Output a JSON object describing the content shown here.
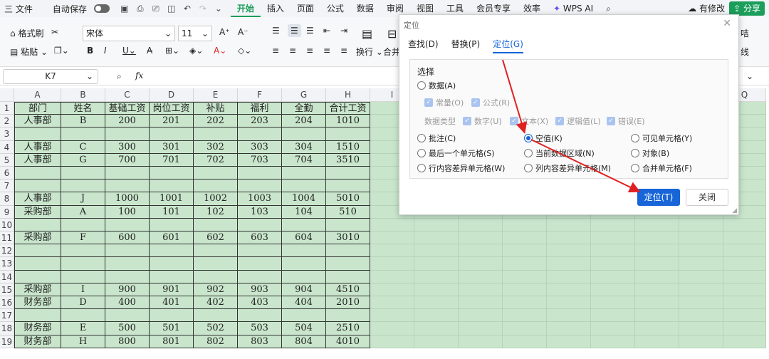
{
  "menubar": {
    "file": "三 文件",
    "autosave": "自动保存",
    "tabs": [
      "开始",
      "插入",
      "页面",
      "公式",
      "数据",
      "审阅",
      "视图",
      "工具",
      "会员专享",
      "效率"
    ],
    "wps_ai": "WPS AI",
    "modify": "有修改",
    "share": "分享"
  },
  "ribbon": {
    "format_painter": "格式刷",
    "paste": "粘贴",
    "font_name": "宋体",
    "font_size": "11",
    "wrap": "换行",
    "merge": "合并",
    "right_cut1": "咭",
    "right_cut2": "线"
  },
  "formula": {
    "namebox": "K7",
    "fx": "fx"
  },
  "grid": {
    "columns": [
      "A",
      "B",
      "C",
      "D",
      "E",
      "F",
      "G",
      "H",
      "I",
      "",
      "",
      "",
      "",
      "",
      "",
      "",
      "Q"
    ],
    "rows": [
      {
        "n": "1",
        "cells": [
          "部门",
          "姓名",
          "基础工资",
          "岗位工资",
          "补贴",
          "福利",
          "全勤",
          "合计工资"
        ]
      },
      {
        "n": "2",
        "cells": [
          "人事部",
          "B",
          "200",
          "201",
          "202",
          "203",
          "204",
          "1010"
        ]
      },
      {
        "n": "3",
        "cells": [
          "",
          "",
          "",
          "",
          "",
          "",
          "",
          ""
        ]
      },
      {
        "n": "4",
        "cells": [
          "人事部",
          "C",
          "300",
          "301",
          "302",
          "303",
          "304",
          "1510"
        ]
      },
      {
        "n": "5",
        "cells": [
          "人事部",
          "G",
          "700",
          "701",
          "702",
          "703",
          "704",
          "3510"
        ]
      },
      {
        "n": "6",
        "cells": [
          "",
          "",
          "",
          "",
          "",
          "",
          "",
          ""
        ]
      },
      {
        "n": "7",
        "cells": [
          "",
          "",
          "",
          "",
          "",
          "",
          "",
          ""
        ]
      },
      {
        "n": "8",
        "cells": [
          "人事部",
          "J",
          "1000",
          "1001",
          "1002",
          "1003",
          "1004",
          "5010"
        ]
      },
      {
        "n": "9",
        "cells": [
          "采购部",
          "A",
          "100",
          "101",
          "102",
          "103",
          "104",
          "510"
        ]
      },
      {
        "n": "10",
        "cells": [
          "",
          "",
          "",
          "",
          "",
          "",
          "",
          ""
        ]
      },
      {
        "n": "11",
        "cells": [
          "采购部",
          "F",
          "600",
          "601",
          "602",
          "603",
          "604",
          "3010"
        ]
      },
      {
        "n": "12",
        "cells": [
          "",
          "",
          "",
          "",
          "",
          "",
          "",
          ""
        ]
      },
      {
        "n": "13",
        "cells": [
          "",
          "",
          "",
          "",
          "",
          "",
          "",
          ""
        ]
      },
      {
        "n": "14",
        "cells": [
          "",
          "",
          "",
          "",
          "",
          "",
          "",
          ""
        ]
      },
      {
        "n": "15",
        "cells": [
          "采购部",
          "I",
          "900",
          "901",
          "902",
          "903",
          "904",
          "4510"
        ]
      },
      {
        "n": "16",
        "cells": [
          "财务部",
          "D",
          "400",
          "401",
          "402",
          "403",
          "404",
          "2010"
        ]
      },
      {
        "n": "17",
        "cells": [
          "",
          "",
          "",
          "",
          "",
          "",
          "",
          ""
        ]
      },
      {
        "n": "18",
        "cells": [
          "财务部",
          "E",
          "500",
          "501",
          "502",
          "503",
          "504",
          "2510"
        ]
      },
      {
        "n": "19",
        "cells": [
          "财务部",
          "H",
          "800",
          "801",
          "802",
          "803",
          "804",
          "4010"
        ]
      }
    ]
  },
  "dialog": {
    "title": "定位",
    "tabs": [
      "查找(D)",
      "替换(P)",
      "定位(G)"
    ],
    "section": "选择",
    "data_radio": "数据(A)",
    "const": "常量(O)",
    "formula": "公式(R)",
    "datatype": "数据类型",
    "number": "数字(U)",
    "text": "文本(X)",
    "logic": "逻辑值(L)",
    "error": "错误(E)",
    "options": [
      [
        "批注(C)",
        "空值(K)",
        "可见单元格(Y)"
      ],
      [
        "最后一个单元格(S)",
        "当前数据区域(N)",
        "对象(B)"
      ],
      [
        "行内容差异单元格(W)",
        "列内容差异单元格(M)",
        "合并单元格(F)"
      ]
    ],
    "ok": "定位(T)",
    "cancel": "关闭"
  },
  "colors": {
    "accent": "#1b9e5a",
    "dialog_blue": "#1765d8",
    "cell_green": "#c9e6cc",
    "arrow": "#e02020"
  }
}
